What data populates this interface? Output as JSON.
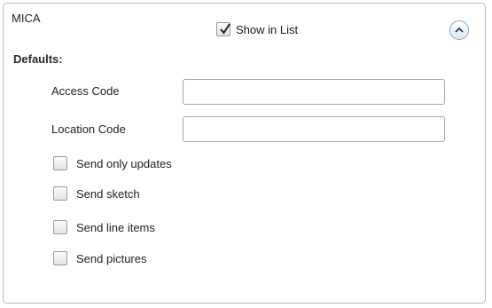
{
  "panel": {
    "title": "MICA",
    "show_in_list": {
      "label": "Show in List",
      "checked": true
    },
    "collapse_icon": "chevron-up-icon"
  },
  "defaults": {
    "heading": "Defaults:",
    "access_code": {
      "label": "Access Code",
      "value": "",
      "placeholder": ""
    },
    "location_code": {
      "label": "Location Code",
      "value": "",
      "placeholder": ""
    },
    "options": [
      {
        "label": "Send only updates",
        "checked": false
      },
      {
        "label": "Send sketch",
        "checked": false
      },
      {
        "label": "Send line items",
        "checked": false
      },
      {
        "label": "Send pictures",
        "checked": false
      }
    ]
  },
  "colors": {
    "panel_border": "#b9b9b9",
    "button_border": "#8aa6c4"
  }
}
